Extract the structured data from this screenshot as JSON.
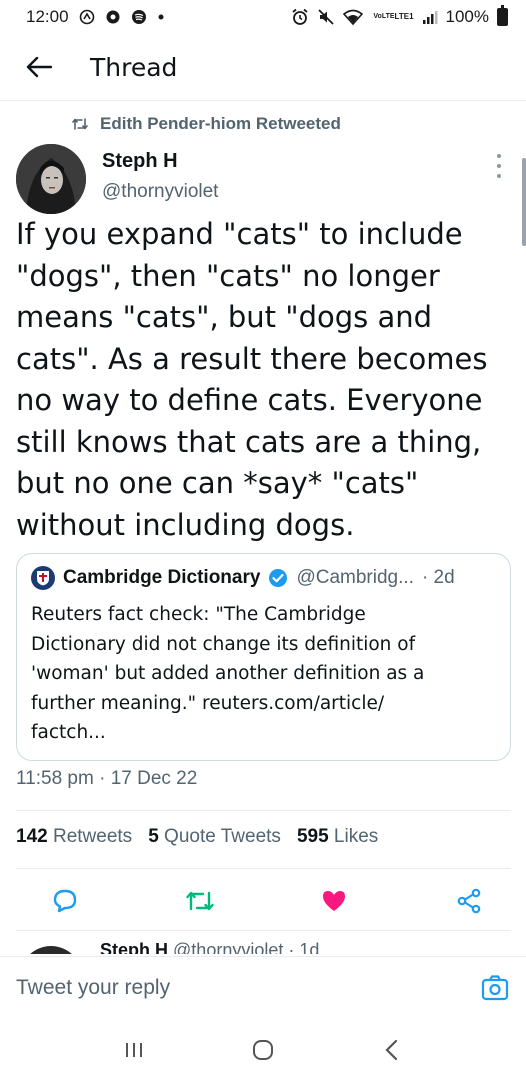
{
  "status_bar": {
    "time": "12:00",
    "battery_percent": "100%",
    "network": "LTE1",
    "volte": "VoLTE",
    "left_icons": [
      "money-app-icon",
      "location-icon",
      "spotify-icon",
      "dot-icon"
    ],
    "right_icons": [
      "alarm-icon",
      "mute-icon",
      "wifi-icon",
      "signal-icon",
      "battery-icon"
    ]
  },
  "header": {
    "title": "Thread"
  },
  "tweet": {
    "retweeted_by": "Edith Pender-hiom Retweeted",
    "author_name": "Steph H",
    "author_handle": "@thornyviolet",
    "text": "If you expand \"cats\" to include\n\"dogs\", then \"cats\" no longer\nmeans \"cats\", but \"dogs and\ncats\". As a result there becomes\nno way to define cats. Everyone\nstill knows that cats are a thing,\nbut no one can *say* \"cats\"\nwithout including dogs.",
    "timestamp": "11:58 pm · 17 Dec 22"
  },
  "quote": {
    "name": "Cambridge Dictionary",
    "handle": "@Cambridg...",
    "time": "· 2d",
    "text": "Reuters fact check: \"The Cambridge\nDictionary did not change its definition of\n'woman' but added another definition as a\nfurther meaning.\" reuters.com/article/\nfactch..."
  },
  "stats": {
    "retweets_count": "142",
    "retweets_label": "Retweets",
    "quotes_count": "5",
    "quotes_label": "Quote Tweets",
    "likes_count": "595",
    "likes_label": "Likes"
  },
  "next_tweet": {
    "author_name": "Steph H",
    "author_handle": "@thornyviolet",
    "time": "· 1d"
  },
  "reply": {
    "placeholder": "Tweet your reply"
  },
  "colors": {
    "accent": "#1d9bf0",
    "retweet_green": "#00ba7c",
    "like_pink": "#f91880",
    "muted": "#536471"
  }
}
